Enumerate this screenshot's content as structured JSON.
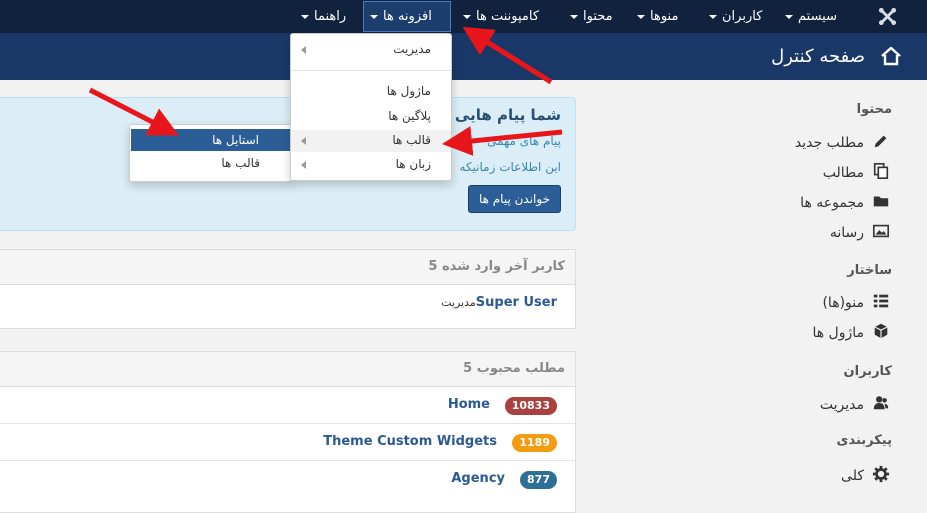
{
  "topnav": {
    "items": [
      {
        "label": "سیستم"
      },
      {
        "label": "کاربران"
      },
      {
        "label": "منوها"
      },
      {
        "label": "محتوا"
      },
      {
        "label": "کامپوننت ها"
      },
      {
        "label": "افزونه ها"
      },
      {
        "label": "راهنما"
      }
    ],
    "logo_icon": "joomla-logo",
    "colors": {
      "bar": "#10223e",
      "active": "#1c3d6e"
    }
  },
  "header": {
    "title": "صفحه کنترل",
    "icon": "home-icon",
    "color": "#1a3867"
  },
  "sidebar": {
    "sections": [
      {
        "heading": "محتوا",
        "items": [
          {
            "label": "مطلب جدید",
            "icon": "pencil-icon"
          },
          {
            "label": "مطالب",
            "icon": "copy-icon"
          },
          {
            "label": "مجموعه ها",
            "icon": "folder-icon"
          },
          {
            "label": "رسانه",
            "icon": "image-icon"
          }
        ]
      },
      {
        "heading": "ساختار",
        "items": [
          {
            "label": "منو(ها)",
            "icon": "list-icon"
          },
          {
            "label": "ماژول ها",
            "icon": "cube-icon"
          }
        ]
      },
      {
        "heading": "کاربران",
        "items": [
          {
            "label": "مدیریت",
            "icon": "users-icon"
          }
        ]
      },
      {
        "heading": "پیکربندی",
        "items": [
          {
            "label": "کلی",
            "icon": "gear-icon"
          }
        ]
      }
    ]
  },
  "alert": {
    "title": "شما پیام هایی د",
    "title_tail": "د",
    "line1": "پیام های مهمی",
    "line2": "این اطلاعات زمانیکه",
    "button": "خواندن پیام ها"
  },
  "panel_users": {
    "heading": "5 کاربر آخر وارد شده",
    "rows": [
      {
        "name": "Super User",
        "role": "مدیریت"
      }
    ]
  },
  "panel_popular": {
    "heading": "5 مطلب محبوب",
    "rows": [
      {
        "title": "Home",
        "hits": "10833",
        "color": "#a9423f"
      },
      {
        "title": "Theme Custom Widgets",
        "hits": "1189",
        "color": "#f39c12"
      },
      {
        "title": "Agency",
        "hits": "877",
        "color": "#2e6f96"
      }
    ]
  },
  "dropdown": {
    "items": [
      {
        "label": "مدیریت",
        "submenu": true
      },
      {
        "label": "ماژول ها",
        "submenu": false
      },
      {
        "label": "پلاگین ها",
        "submenu": false
      },
      {
        "label": "قالب ها",
        "submenu": true
      },
      {
        "label": "زبان ها",
        "submenu": true
      }
    ]
  },
  "submenu": {
    "items": [
      {
        "label": "استایل ها",
        "active": true
      },
      {
        "label": "قالب ها",
        "active": false
      }
    ]
  },
  "annotation_color": "#e8161b"
}
